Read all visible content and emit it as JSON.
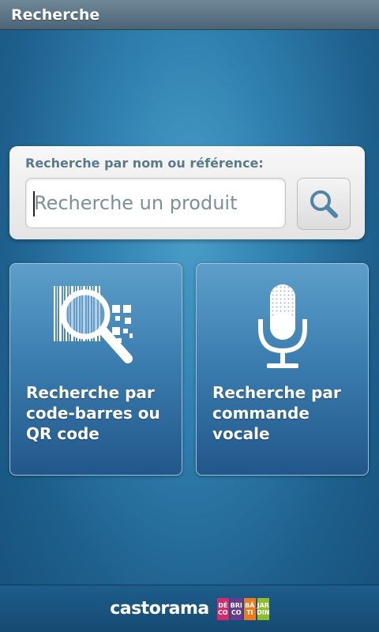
{
  "app": {
    "title": "Recherche"
  },
  "search": {
    "label": "Recherche par nom ou référence:",
    "placeholder": "Recherche un produit",
    "value": ""
  },
  "tiles": [
    {
      "label": "Recherche par code-barres ou QR code",
      "icon": "barcode-magnifier-icon"
    },
    {
      "label": "Recherche par commande vocale",
      "icon": "microphone-icon"
    }
  ],
  "footer": {
    "brand": "castorama",
    "chips": [
      {
        "line1": "DÉ",
        "line2": "CO",
        "color": "#d42a6b"
      },
      {
        "line1": "BRI",
        "line2": "CO",
        "color": "#6a3b8f"
      },
      {
        "line1": "BÂ",
        "line2": "TI",
        "color": "#f07a1a"
      },
      {
        "line1": "JAR",
        "line2": "DIN",
        "color": "#8dbf2a"
      }
    ]
  }
}
